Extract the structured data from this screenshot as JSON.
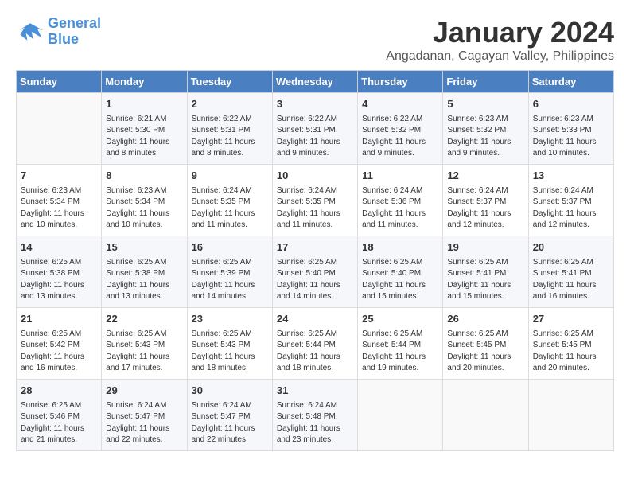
{
  "header": {
    "logo_line1": "General",
    "logo_line2": "Blue",
    "month": "January 2024",
    "location": "Angadanan, Cagayan Valley, Philippines"
  },
  "columns": [
    "Sunday",
    "Monday",
    "Tuesday",
    "Wednesday",
    "Thursday",
    "Friday",
    "Saturday"
  ],
  "weeks": [
    [
      {
        "day": "",
        "info": ""
      },
      {
        "day": "1",
        "info": "Sunrise: 6:21 AM\nSunset: 5:30 PM\nDaylight: 11 hours\nand 8 minutes."
      },
      {
        "day": "2",
        "info": "Sunrise: 6:22 AM\nSunset: 5:31 PM\nDaylight: 11 hours\nand 8 minutes."
      },
      {
        "day": "3",
        "info": "Sunrise: 6:22 AM\nSunset: 5:31 PM\nDaylight: 11 hours\nand 9 minutes."
      },
      {
        "day": "4",
        "info": "Sunrise: 6:22 AM\nSunset: 5:32 PM\nDaylight: 11 hours\nand 9 minutes."
      },
      {
        "day": "5",
        "info": "Sunrise: 6:23 AM\nSunset: 5:32 PM\nDaylight: 11 hours\nand 9 minutes."
      },
      {
        "day": "6",
        "info": "Sunrise: 6:23 AM\nSunset: 5:33 PM\nDaylight: 11 hours\nand 10 minutes."
      }
    ],
    [
      {
        "day": "7",
        "info": "Sunrise: 6:23 AM\nSunset: 5:34 PM\nDaylight: 11 hours\nand 10 minutes."
      },
      {
        "day": "8",
        "info": "Sunrise: 6:23 AM\nSunset: 5:34 PM\nDaylight: 11 hours\nand 10 minutes."
      },
      {
        "day": "9",
        "info": "Sunrise: 6:24 AM\nSunset: 5:35 PM\nDaylight: 11 hours\nand 11 minutes."
      },
      {
        "day": "10",
        "info": "Sunrise: 6:24 AM\nSunset: 5:35 PM\nDaylight: 11 hours\nand 11 minutes."
      },
      {
        "day": "11",
        "info": "Sunrise: 6:24 AM\nSunset: 5:36 PM\nDaylight: 11 hours\nand 11 minutes."
      },
      {
        "day": "12",
        "info": "Sunrise: 6:24 AM\nSunset: 5:37 PM\nDaylight: 11 hours\nand 12 minutes."
      },
      {
        "day": "13",
        "info": "Sunrise: 6:24 AM\nSunset: 5:37 PM\nDaylight: 11 hours\nand 12 minutes."
      }
    ],
    [
      {
        "day": "14",
        "info": "Sunrise: 6:25 AM\nSunset: 5:38 PM\nDaylight: 11 hours\nand 13 minutes."
      },
      {
        "day": "15",
        "info": "Sunrise: 6:25 AM\nSunset: 5:38 PM\nDaylight: 11 hours\nand 13 minutes."
      },
      {
        "day": "16",
        "info": "Sunrise: 6:25 AM\nSunset: 5:39 PM\nDaylight: 11 hours\nand 14 minutes."
      },
      {
        "day": "17",
        "info": "Sunrise: 6:25 AM\nSunset: 5:40 PM\nDaylight: 11 hours\nand 14 minutes."
      },
      {
        "day": "18",
        "info": "Sunrise: 6:25 AM\nSunset: 5:40 PM\nDaylight: 11 hours\nand 15 minutes."
      },
      {
        "day": "19",
        "info": "Sunrise: 6:25 AM\nSunset: 5:41 PM\nDaylight: 11 hours\nand 15 minutes."
      },
      {
        "day": "20",
        "info": "Sunrise: 6:25 AM\nSunset: 5:41 PM\nDaylight: 11 hours\nand 16 minutes."
      }
    ],
    [
      {
        "day": "21",
        "info": "Sunrise: 6:25 AM\nSunset: 5:42 PM\nDaylight: 11 hours\nand 16 minutes."
      },
      {
        "day": "22",
        "info": "Sunrise: 6:25 AM\nSunset: 5:43 PM\nDaylight: 11 hours\nand 17 minutes."
      },
      {
        "day": "23",
        "info": "Sunrise: 6:25 AM\nSunset: 5:43 PM\nDaylight: 11 hours\nand 18 minutes."
      },
      {
        "day": "24",
        "info": "Sunrise: 6:25 AM\nSunset: 5:44 PM\nDaylight: 11 hours\nand 18 minutes."
      },
      {
        "day": "25",
        "info": "Sunrise: 6:25 AM\nSunset: 5:44 PM\nDaylight: 11 hours\nand 19 minutes."
      },
      {
        "day": "26",
        "info": "Sunrise: 6:25 AM\nSunset: 5:45 PM\nDaylight: 11 hours\nand 20 minutes."
      },
      {
        "day": "27",
        "info": "Sunrise: 6:25 AM\nSunset: 5:45 PM\nDaylight: 11 hours\nand 20 minutes."
      }
    ],
    [
      {
        "day": "28",
        "info": "Sunrise: 6:25 AM\nSunset: 5:46 PM\nDaylight: 11 hours\nand 21 minutes."
      },
      {
        "day": "29",
        "info": "Sunrise: 6:24 AM\nSunset: 5:47 PM\nDaylight: 11 hours\nand 22 minutes."
      },
      {
        "day": "30",
        "info": "Sunrise: 6:24 AM\nSunset: 5:47 PM\nDaylight: 11 hours\nand 22 minutes."
      },
      {
        "day": "31",
        "info": "Sunrise: 6:24 AM\nSunset: 5:48 PM\nDaylight: 11 hours\nand 23 minutes."
      },
      {
        "day": "",
        "info": ""
      },
      {
        "day": "",
        "info": ""
      },
      {
        "day": "",
        "info": ""
      }
    ]
  ]
}
